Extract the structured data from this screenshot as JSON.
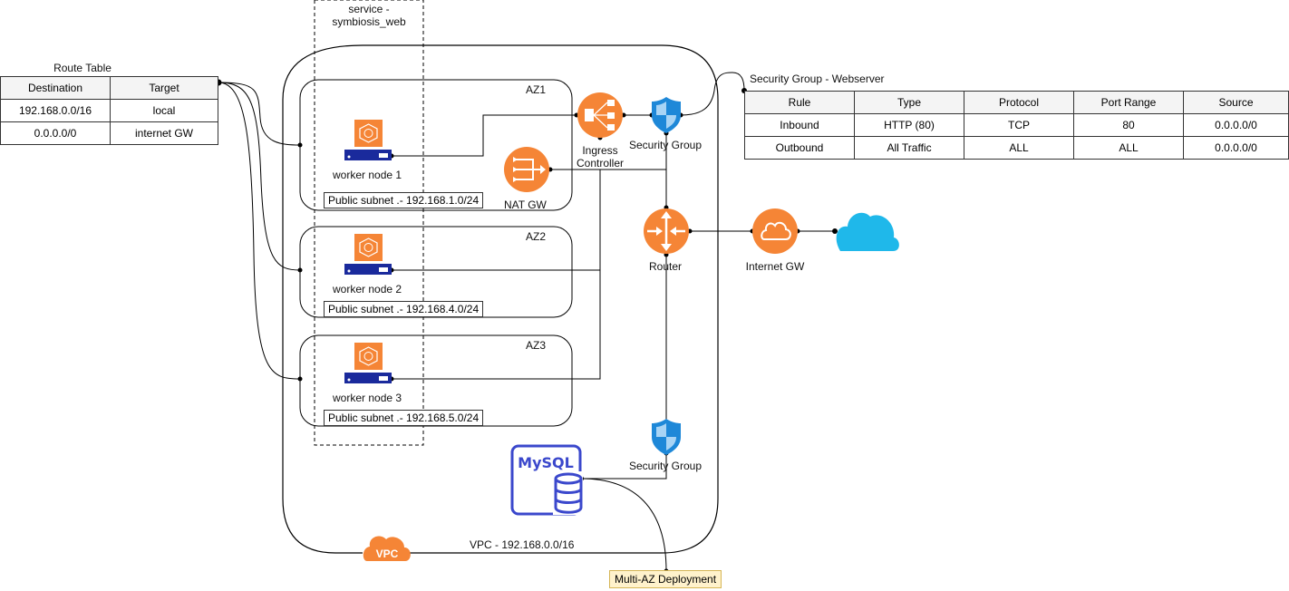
{
  "diagram": {
    "service_label": "service -\nsymbiosis_web",
    "vpc_label": "VPC - 192.168.0.0/16",
    "vpc_badge": "VPC",
    "az": [
      {
        "name": "AZ1",
        "worker": "worker node 1",
        "subnet": "Public subnet .- 192.168.1.0/24"
      },
      {
        "name": "AZ2",
        "worker": "worker node 2",
        "subnet": "Public subnet .- 192.168.4.0/24"
      },
      {
        "name": "AZ3",
        "worker": "worker node 3",
        "subnet": "Public subnet .- 192.168.5.0/24"
      }
    ],
    "ingress_label_1": "Ingress",
    "ingress_label_2": "Controller",
    "nat_label": "NAT GW",
    "security_group_top_label": "Security Group",
    "security_group_db_label": "Security Group",
    "router_label": "Router",
    "internet_gw_label": "Internet GW",
    "mysql_label": "MySQL",
    "multi_az_label": "Multi-AZ Deployment",
    "colors": {
      "aws_orange": "#F58536",
      "shield_blue": "#1E88D8",
      "internet_cloud": "#1FB8EA",
      "mysql_blue": "#3B48CC",
      "note_fill": "#FFF2CC",
      "note_border": "#D6B656"
    }
  },
  "route_table": {
    "title": "Route Table",
    "headers": [
      "Destination",
      "Target"
    ],
    "rows": [
      [
        "192.168.0.0/16",
        "local"
      ],
      [
        "0.0.0.0/0",
        "internet GW"
      ]
    ]
  },
  "security_group_table": {
    "title": "Security Group - Webserver",
    "headers": [
      "Rule",
      "Type",
      "Protocol",
      "Port Range",
      "Source"
    ],
    "rows": [
      [
        "Inbound",
        "HTTP (80)",
        "TCP",
        "80",
        "0.0.0.0/0"
      ],
      [
        "Outbound",
        "All Traffic",
        "ALL",
        "ALL",
        "0.0.0.0/0"
      ]
    ]
  }
}
